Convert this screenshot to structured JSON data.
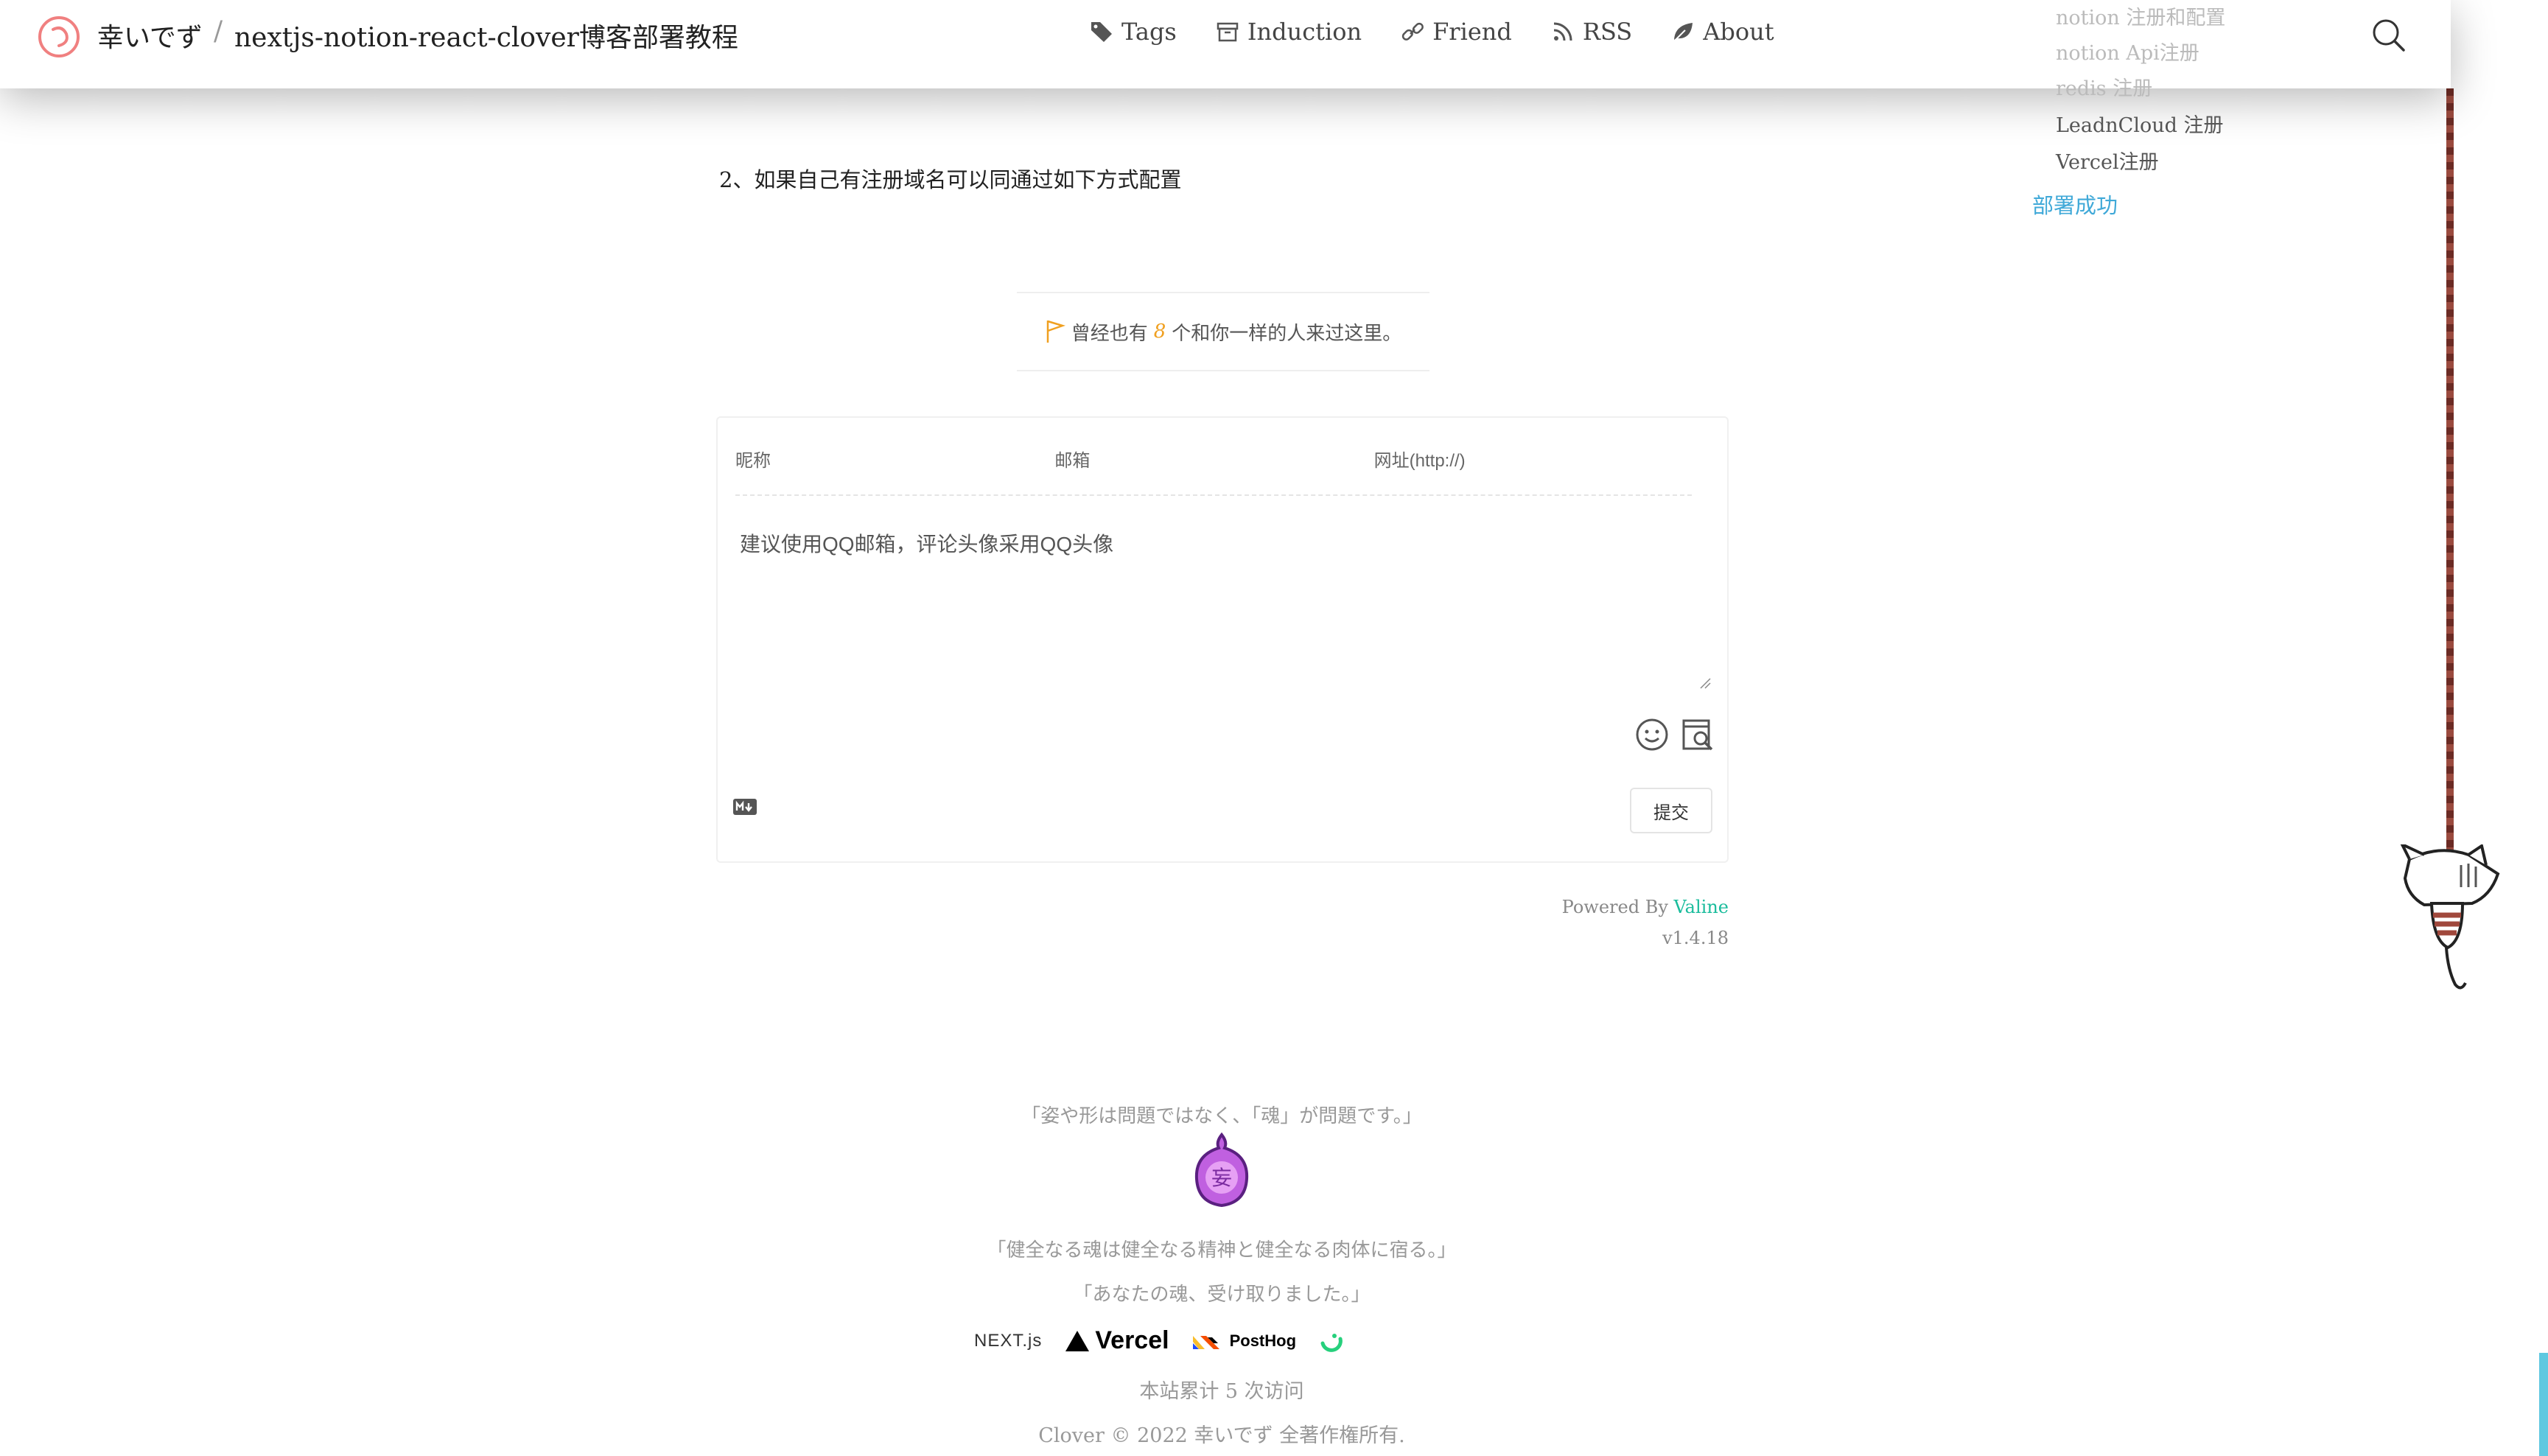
{
  "header": {
    "site_title": "幸いでず",
    "separator": "/",
    "post_title": "nextjs-notion-react-clover博客部署教程",
    "nav": [
      {
        "label": "Tags",
        "icon": "tags-icon"
      },
      {
        "label": "Induction",
        "icon": "archive-icon"
      },
      {
        "label": "Friend",
        "icon": "link-icon"
      },
      {
        "label": "RSS",
        "icon": "rss-icon"
      },
      {
        "label": "About",
        "icon": "leaf-icon"
      }
    ]
  },
  "toc": {
    "items": [
      "notion 注册和配置",
      "notion Api注册",
      "redis 注册",
      "LeadnCloud 注册",
      "Vercel注册"
    ],
    "active": "部署成功"
  },
  "article": {
    "paragraph": "2、如果自己有注册域名可以同通过如下方式配置"
  },
  "visits": {
    "prefix": "曾经也有",
    "count": "8",
    "suffix": "个和你一样的人来过这里。"
  },
  "comment": {
    "nickname_placeholder": "昵称",
    "email_placeholder": "邮箱",
    "url_placeholder": "网址(http://)",
    "textarea_placeholder": "建议使用QQ邮箱，评论头像采用QQ头像",
    "submit_label": "提交",
    "powered_prefix": "Powered By",
    "powered_link": "Valine",
    "version": "v1.4.18"
  },
  "footer": {
    "quote1": "「姿や形は問題ではなく、「魂」が問題です。」",
    "quote2": "「健全なる魂は健全なる精神と健全なる肉体に宿る。」",
    "quote3": "「あなたの魂、受け取りました。」",
    "sponsors": {
      "next": "NEXT.js",
      "vercel": "Vercel",
      "posthog": "PostHog"
    },
    "stats": "本站累计 5 次访问",
    "copyright": "Clover © 2022 幸いでず 全著作権所有."
  },
  "colors": {
    "accent": "#40a9d8",
    "count": "#f0a020",
    "valine": "#1abc9c"
  }
}
